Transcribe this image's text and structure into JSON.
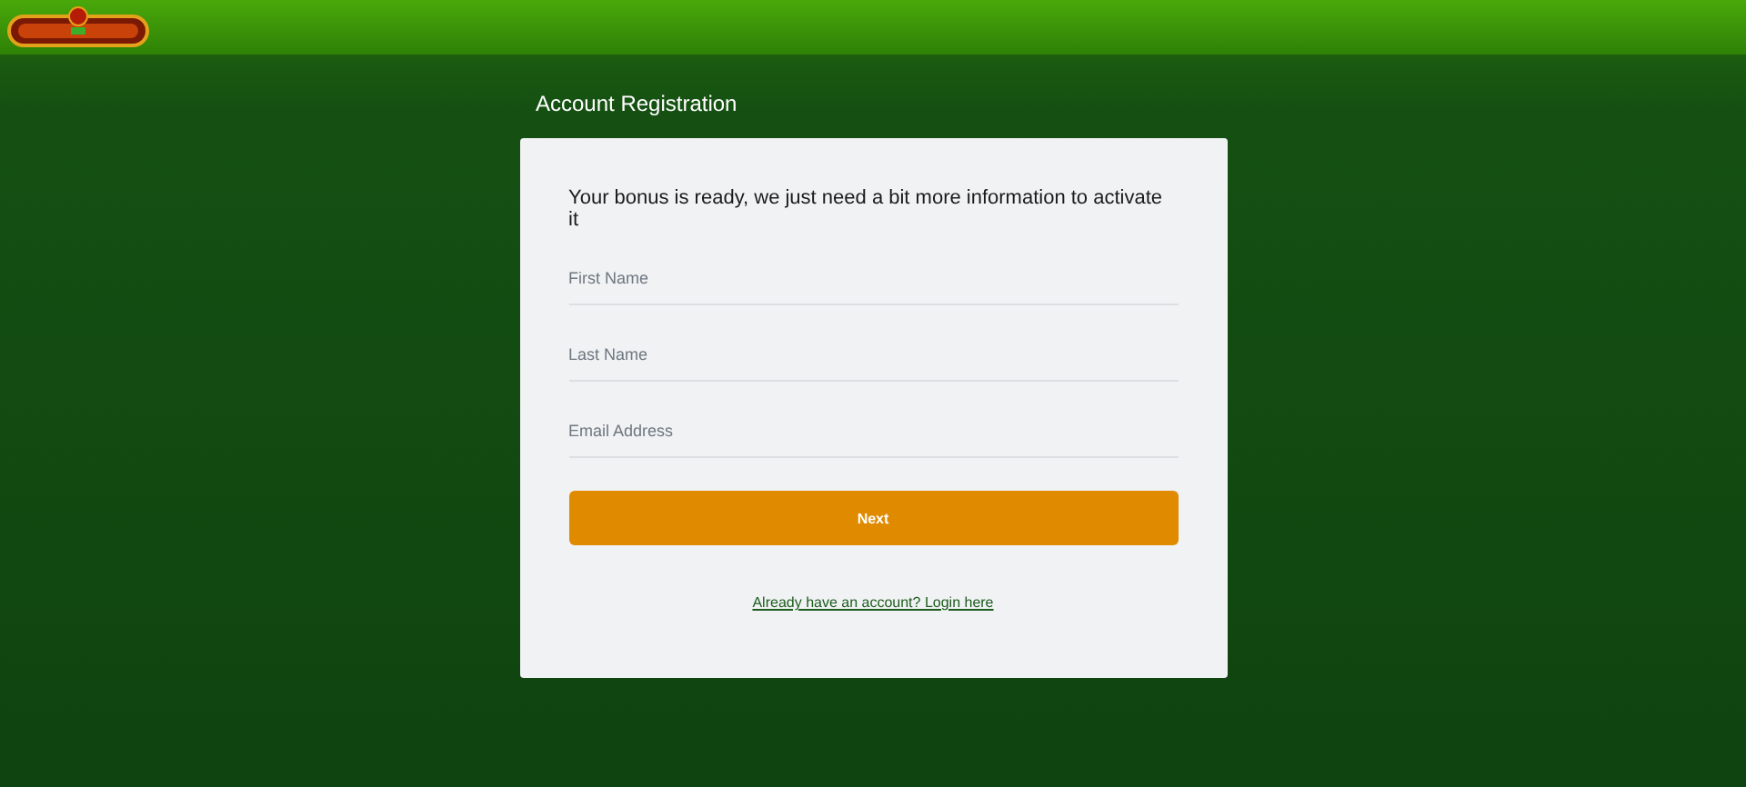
{
  "header": {
    "logo": {
      "kind": "logo"
    }
  },
  "form": {
    "title": "Account Registration",
    "intro": "Your bonus is ready, we just need a bit more information to activate it",
    "fields": [
      {
        "placeholder": "First Name"
      },
      {
        "placeholder": "Last Name"
      },
      {
        "placeholder": "Email Address"
      }
    ],
    "submit": "Next",
    "login_link": "Already have an account? Login here"
  }
}
